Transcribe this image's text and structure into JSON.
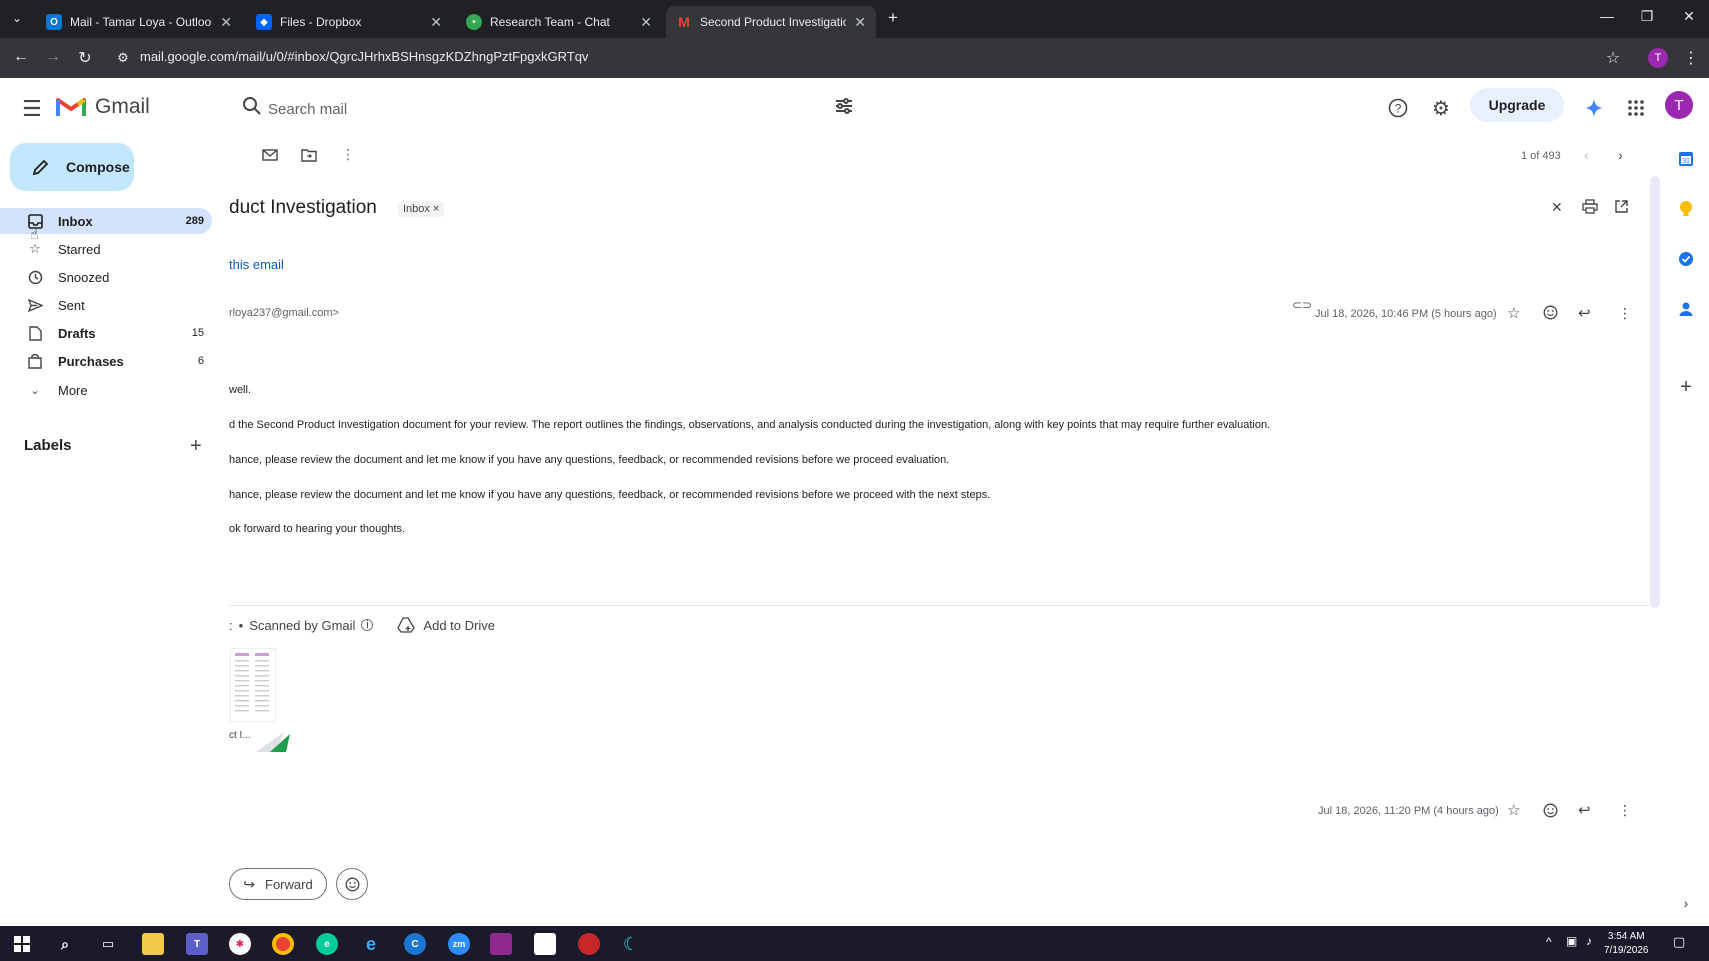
{
  "browser": {
    "tabs": [
      {
        "title": "Mail - Tamar Loya - Outlook",
        "active": false,
        "favicon": "outlook-icon",
        "color": "#0078d4"
      },
      {
        "title": "Files - Dropbox",
        "active": false,
        "favicon": "dropbox-icon",
        "color": "#0061fe"
      },
      {
        "title": "Research Team - Chat",
        "active": false,
        "favicon": "chat-icon",
        "color": "#34a853"
      },
      {
        "title": "Second Product Investigation -",
        "active": true,
        "favicon": "gmail-icon",
        "color": "#ea4335"
      }
    ],
    "url": "mail.google.com/mail/u/0/#inbox/QgrcJHrhxBSHnsgzKDZhngPztFpgxkGRTqv",
    "profile_initial": "T"
  },
  "gmail": {
    "logo_text": "Gmail",
    "search_placeholder": "Search mail",
    "upgrade_label": "Upgrade",
    "avatar_initial": "T",
    "compose_label": "Compose",
    "nav": [
      {
        "label": "Inbox",
        "count": "289",
        "icon": "inbox-icon",
        "active": true,
        "bold": true
      },
      {
        "label": "Starred",
        "count": "",
        "icon": "star-icon",
        "active": false,
        "bold": false
      },
      {
        "label": "Snoozed",
        "count": "",
        "icon": "clock-icon",
        "active": false,
        "bold": false
      },
      {
        "label": "Sent",
        "count": "",
        "icon": "send-icon",
        "active": false,
        "bold": false
      },
      {
        "label": "Drafts",
        "count": "15",
        "icon": "draft-icon",
        "active": false,
        "bold": true
      },
      {
        "label": "Purchases",
        "count": "6",
        "icon": "purchases-icon",
        "active": false,
        "bold": true
      },
      {
        "label": "More",
        "count": "",
        "icon": "chevron-down-icon",
        "active": false,
        "bold": false
      }
    ],
    "labels_title": "Labels",
    "pager": "1 of 493"
  },
  "email": {
    "subject": "duct Investigation",
    "inbox_chip": "Inbox",
    "summarize": "this email",
    "sender_email": "rloya237@gmail.com>",
    "date1": "Jul 18, 2026, 10:46 PM (5 hours ago)",
    "body": [
      "well.",
      "d the Second Product Investigation document for your review. The report outlines the findings, observations, and analysis conducted during the investigation, along with key points that may require further evaluation.",
      "hance, please review the document and let me know if you have any questions, feedback, or recommended revisions before we proceed evaluation.",
      "hance, please review the document and let me know if you have any questions, feedback, or recommended revisions before we proceed with the next steps.",
      "ok forward to hearing your thoughts."
    ],
    "attachment_prefix": ":",
    "scanned_label": "Scanned by Gmail",
    "add_to_drive": "Add to Drive",
    "attachment_name": "ct I...",
    "date2": "Jul 18, 2026, 11:20 PM (4 hours ago)",
    "forward_label": "Forward"
  },
  "taskbar": {
    "time": "3:54 AM",
    "date": "7/19/2026"
  },
  "colors": {
    "accent": "#0b57d0",
    "compose_bg": "#c2e7ff",
    "active_nav_bg": "#d3e3fd"
  }
}
